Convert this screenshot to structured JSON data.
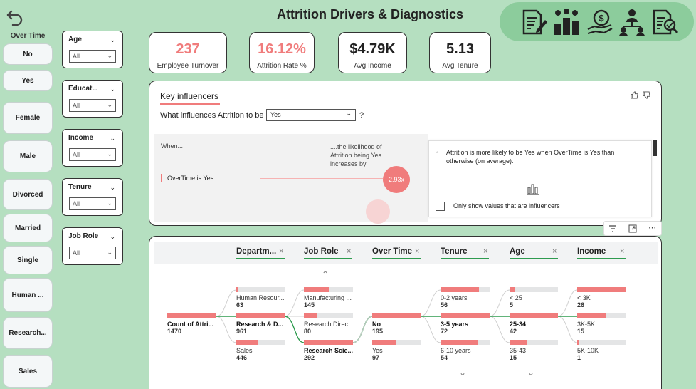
{
  "title": "Attrition Drivers & Diagnostics",
  "nav": {
    "back_icon": "back-arrow-icon",
    "icons": [
      "report-pen-icon",
      "team-chart-icon",
      "money-hand-icon",
      "org-structure-icon",
      "diagnostics-icon"
    ]
  },
  "filters": {
    "group_label": "Over Time",
    "buttons": [
      "No",
      "Yes",
      "Female",
      "Male",
      "Divorced",
      "Married",
      "Single",
      "Human ...",
      "Research...",
      "Sales"
    ]
  },
  "slicers": [
    {
      "title": "Age",
      "value": "All"
    },
    {
      "title": "Educat...",
      "value": "All"
    },
    {
      "title": "Income",
      "value": "All"
    },
    {
      "title": "Tenure",
      "value": "All"
    },
    {
      "title": "Job Role",
      "value": "All"
    }
  ],
  "kpis": [
    {
      "value": "237",
      "label": "Employee Turnover",
      "color": "#f07c7c"
    },
    {
      "value": "16.12%",
      "label": "Attrition Rate %",
      "color": "#f07c7c"
    },
    {
      "value": "$4.79K",
      "label": "Avg Income",
      "color": "#222222"
    },
    {
      "value": "5.13",
      "label": "Avg Tenure",
      "color": "#222222"
    }
  ],
  "key_influencers": {
    "tab": "Key influencers",
    "question": "What influences Attrition to be",
    "question_value": "Yes",
    "question_end": "?",
    "col_when": "When...",
    "col_likelihood": "....the likelihood of Attrition being Yes increases by",
    "row_label": "OverTime is Yes",
    "row_value": "2.93x",
    "detail_text": "Attrition is more likely to be Yes when OverTime is Yes than otherwise (on average).",
    "checkbox_label": "Only show values that are influencers"
  },
  "tree": {
    "headers": [
      "Departm...",
      "Job Role",
      "Over Time",
      "Tenure",
      "Age",
      "Income"
    ],
    "root": {
      "name": "Count of Attri...",
      "value": "1470"
    },
    "columns": [
      [
        {
          "name": "Human Resour...",
          "value": "63",
          "fill": 0.05
        },
        {
          "name": "Research & D...",
          "value": "961",
          "fill": 1.0,
          "bold": true
        },
        {
          "name": "Sales",
          "value": "446",
          "fill": 0.45
        }
      ],
      [
        {
          "name": "Manufacturing ...",
          "value": "145",
          "fill": 0.5
        },
        {
          "name": "Research Direc...",
          "value": "80",
          "fill": 0.27
        },
        {
          "name": "Research Scie...",
          "value": "292",
          "fill": 1.0,
          "bold": true
        }
      ],
      [
        {
          "name": "No",
          "value": "195",
          "fill": 1.0,
          "bold": true
        },
        {
          "name": "Yes",
          "value": "97",
          "fill": 0.5
        }
      ],
      [
        {
          "name": "0-2 years",
          "value": "56",
          "fill": 0.78
        },
        {
          "name": "3-5 years",
          "value": "72",
          "fill": 1.0,
          "bold": true
        },
        {
          "name": "6-10 years",
          "value": "54",
          "fill": 0.75
        }
      ],
      [
        {
          "name": "< 25",
          "value": "5",
          "fill": 0.12
        },
        {
          "name": "25-34",
          "value": "42",
          "fill": 1.0,
          "bold": true
        },
        {
          "name": "35-43",
          "value": "15",
          "fill": 0.36
        }
      ],
      [
        {
          "name": "< 3K",
          "value": "26",
          "fill": 1.0
        },
        {
          "name": "3K-5K",
          "value": "15",
          "fill": 0.58
        },
        {
          "name": "5K-10K",
          "value": "1",
          "fill": 0.04
        }
      ]
    ]
  }
}
